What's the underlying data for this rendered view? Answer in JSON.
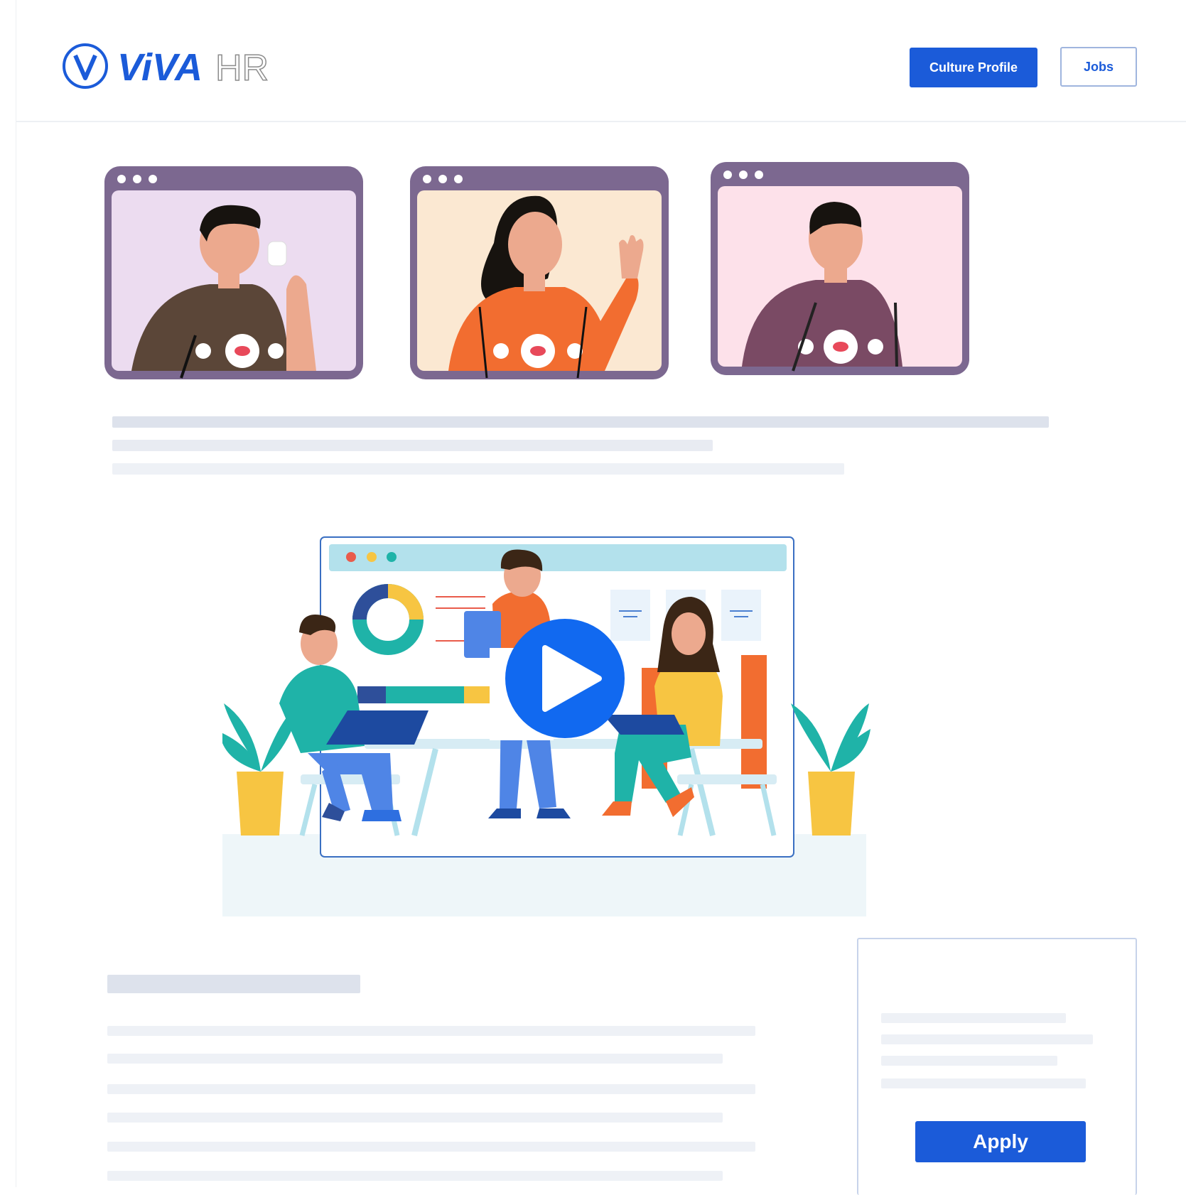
{
  "brand": {
    "logo_text_bold": "ViVA",
    "logo_text_light": "HR"
  },
  "header": {
    "culture_profile_label": "Culture Profile",
    "jobs_label": "Jobs"
  },
  "video": {
    "play_icon": "play-icon"
  },
  "apply": {
    "apply_label": "Apply"
  },
  "colors": {
    "accent": "#1b5bd9",
    "window_frame": "#7c6890"
  }
}
